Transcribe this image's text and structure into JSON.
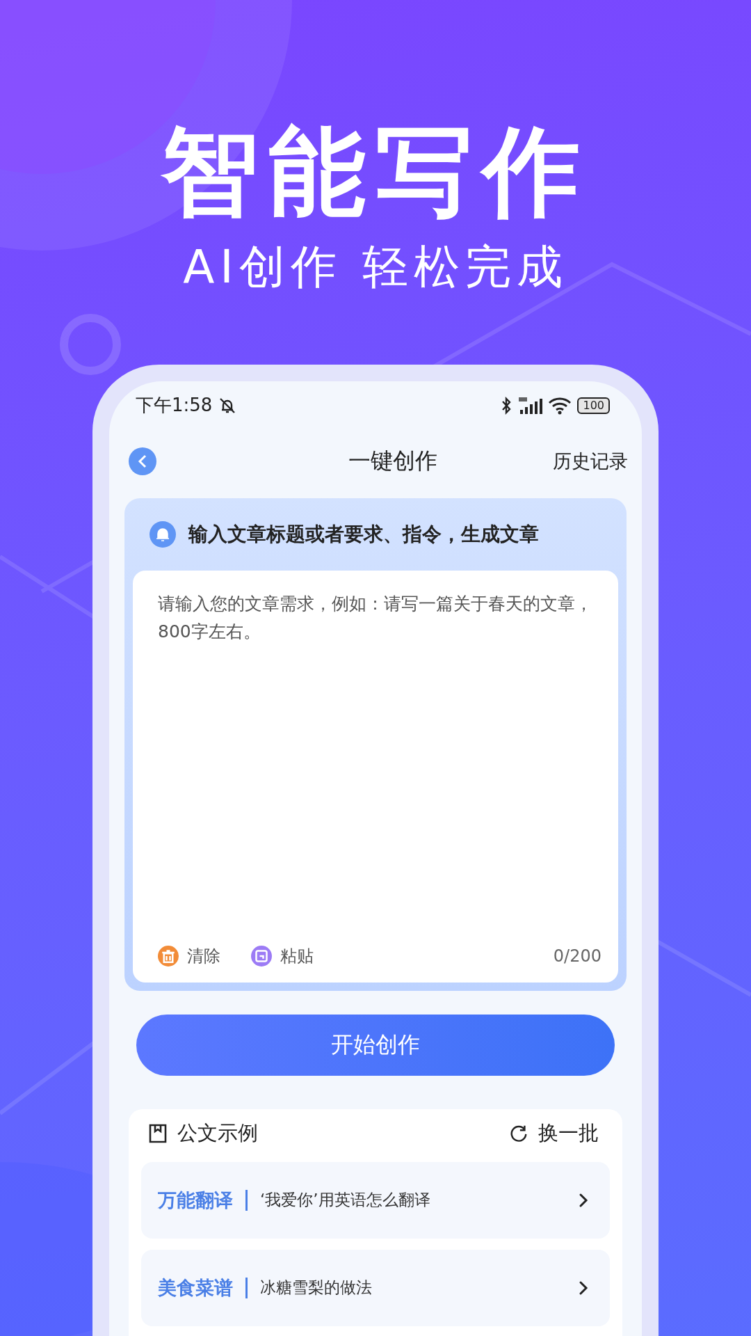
{
  "hero": {
    "title": "智能写作",
    "subtitle": "AI创作 轻松完成"
  },
  "status_bar": {
    "time": "下午1:58",
    "battery": "100"
  },
  "header": {
    "title": "一键创作",
    "history": "历史记录"
  },
  "prompt_card": {
    "hint": "输入文章标题或者要求、指令，生成文章",
    "placeholder": "请输入您的文章需求，例如：请写一篇关于春天的文章，800字左右。",
    "counter": "0/200",
    "actions": [
      {
        "kind": "clear",
        "label": "清除"
      },
      {
        "kind": "paste",
        "label": "粘贴"
      }
    ]
  },
  "start_button": "开始创作",
  "examples": {
    "title": "公文示例",
    "refresh": "换一批",
    "items": [
      {
        "category": "万能翻译",
        "text": "‘我爱你’用英语怎么翻译"
      },
      {
        "category": "美食菜谱",
        "text": "冰糖雪梨的做法"
      }
    ]
  }
}
